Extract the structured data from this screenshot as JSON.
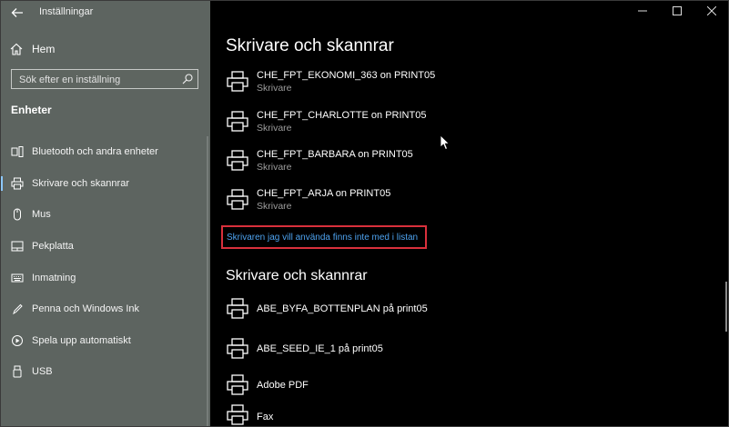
{
  "window": {
    "title": "Inställningar",
    "controls": [
      "minimize-icon",
      "maximize-icon",
      "close-icon"
    ]
  },
  "sidebar": {
    "home_label": "Hem",
    "search_placeholder": "Sök efter en inställning",
    "section_heading": "Enheter",
    "items": [
      {
        "label": "Bluetooth och andra enheter",
        "icon": "bluetooth-icon",
        "active": false
      },
      {
        "label": "Skrivare och skannrar",
        "icon": "printer-icon",
        "active": true
      },
      {
        "label": "Mus",
        "icon": "mouse-icon",
        "active": false
      },
      {
        "label": "Pekplatta",
        "icon": "touchpad-icon",
        "active": false
      },
      {
        "label": "Inmatning",
        "icon": "keyboard-icon",
        "active": false
      },
      {
        "label": "Penna och Windows Ink",
        "icon": "pen-icon",
        "active": false
      },
      {
        "label": "Spela upp automatiskt",
        "icon": "autoplay-icon",
        "active": false
      },
      {
        "label": "USB",
        "icon": "usb-icon",
        "active": false
      }
    ]
  },
  "main": {
    "heading": "Skrivare och skannrar",
    "printers_top": [
      {
        "name": "CHE_FPT_EKONOMI_363 on PRINT05",
        "type": "Skrivare"
      },
      {
        "name": "CHE_FPT_CHARLOTTE on PRINT05",
        "type": "Skrivare"
      },
      {
        "name": "CHE_FPT_BARBARA on PRINT05",
        "type": "Skrivare"
      },
      {
        "name": "CHE_FPT_ARJA on PRINT05",
        "type": "Skrivare"
      }
    ],
    "missing_link": "Skrivaren jag vill använda finns inte med i listan",
    "heading2": "Skrivare och skannrar",
    "printers_bottom": [
      {
        "name": "ABE_BYFA_BOTTENPLAN på print05"
      },
      {
        "name": "ABE_SEED_IE_1 på print05"
      },
      {
        "name": "Adobe PDF"
      },
      {
        "name": "Fax"
      }
    ]
  },
  "colors": {
    "sidebar_bg": "#5d6460",
    "main_bg": "#000000",
    "link": "#4ea3f0",
    "highlight_border": "#d9303c",
    "active_indicator": "#8cc8ff"
  }
}
